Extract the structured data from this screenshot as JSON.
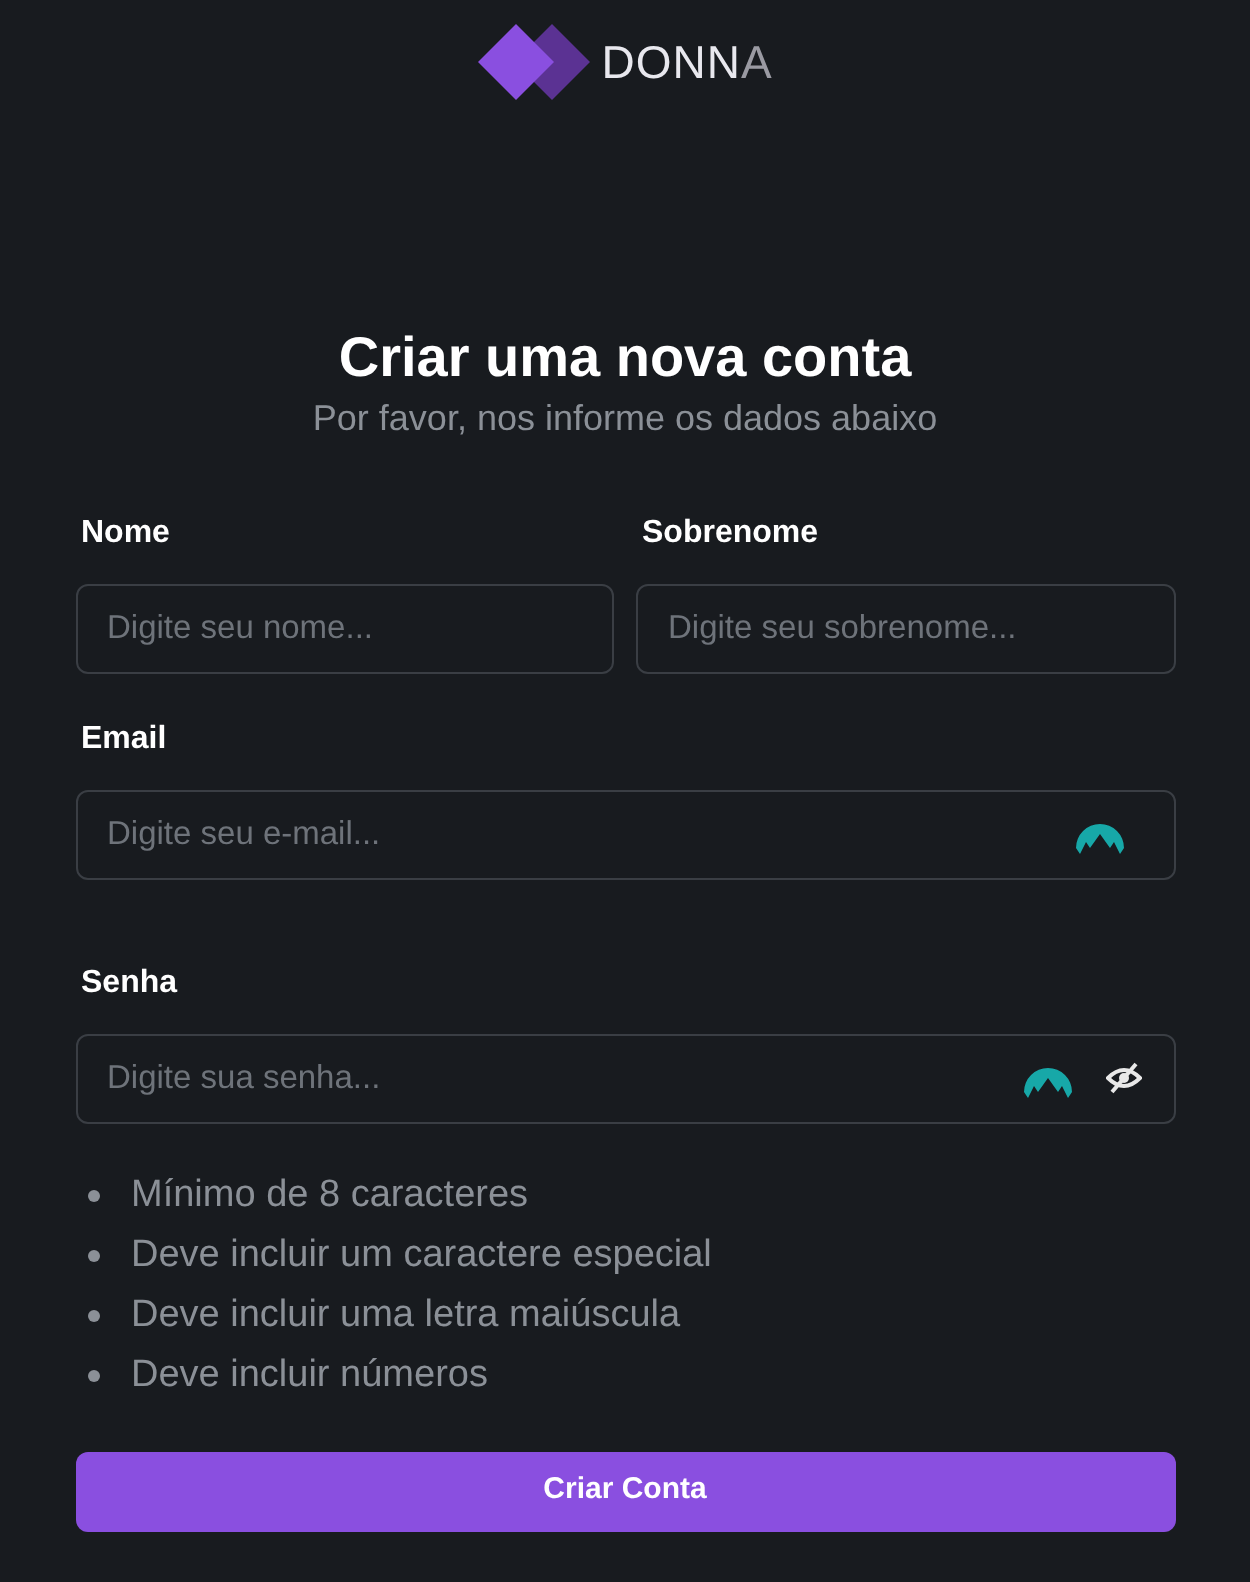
{
  "logo": {
    "main": "DONN",
    "accent": "A"
  },
  "heading": {
    "title": "Criar uma nova conta",
    "subtitle": "Por favor, nos informe os dados abaixo"
  },
  "rows": [
    [
      {
        "label": "Nome",
        "placeholder": "Digite seu nome...",
        "kind": "text"
      },
      {
        "label": "Sobrenome",
        "placeholder": "Digite seu sobrenome...",
        "kind": "text"
      }
    ],
    [
      {
        "label": "Email",
        "placeholder": "Digite seu e-mail...",
        "kind": "email"
      }
    ],
    [
      {
        "label": "Senha",
        "placeholder": "Digite sua senha...",
        "kind": "password"
      }
    ]
  ],
  "requirements": [
    "Mínimo de 8 caracteres",
    "Deve incluir um caractere especial",
    "Deve incluir uma letra maiúscula",
    "Deve incluir números"
  ],
  "submit": "Criar Conta"
}
